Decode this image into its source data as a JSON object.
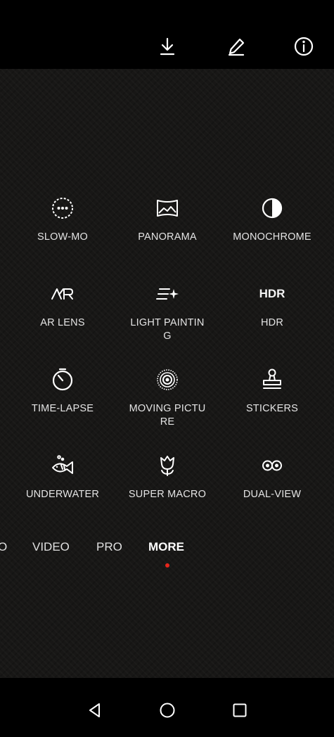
{
  "top_actions": {
    "download_icon": "download-icon",
    "edit_icon": "pencil-icon",
    "info_icon": "info-icon"
  },
  "modes": [
    {
      "label": "SLOW-MO",
      "icon": "slow-mo-icon"
    },
    {
      "label": "PANORAMA",
      "icon": "panorama-icon"
    },
    {
      "label": "MONOCHROME",
      "icon": "monochrome-icon"
    },
    {
      "label": "AR LENS",
      "icon": "ar-lens-icon"
    },
    {
      "label": "LIGHT PAINTING",
      "icon": "light-painting-icon"
    },
    {
      "label": "HDR",
      "icon_text": "HDR",
      "icon": "hdr-icon"
    },
    {
      "label": "TIME-LAPSE",
      "icon": "time-lapse-icon"
    },
    {
      "label": "MOVING PICTURE",
      "icon": "moving-picture-icon"
    },
    {
      "label": "STICKERS",
      "icon": "stickers-icon"
    },
    {
      "label": "UNDERWATER",
      "icon": "underwater-icon"
    },
    {
      "label": "SUPER MACRO",
      "icon": "super-macro-icon"
    },
    {
      "label": "DUAL-VIEW",
      "icon": "dual-view-icon"
    }
  ],
  "tabs": [
    {
      "label": "O"
    },
    {
      "label": "VIDEO"
    },
    {
      "label": "PRO"
    },
    {
      "label": "MORE",
      "active": true
    }
  ],
  "colors": {
    "active_indicator": "#e8261c",
    "panel_background": "#181716"
  },
  "nav": {
    "back_icon": "back-triangle-icon",
    "home_icon": "home-circle-icon",
    "recents_icon": "recents-square-icon"
  }
}
